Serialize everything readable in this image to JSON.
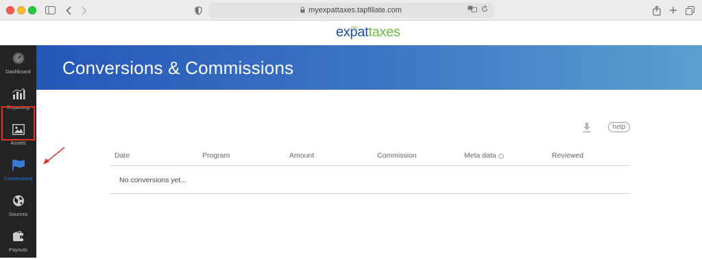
{
  "browser": {
    "url": "myexpattaxes.tapfiliate.com"
  },
  "brand": {
    "my": "my",
    "expat": "expat",
    "taxes": "taxes"
  },
  "sidebar": {
    "items": [
      {
        "label": "Dashboard",
        "icon": "speedometer-icon"
      },
      {
        "label": "Reporting",
        "icon": "bar-chart-icon"
      },
      {
        "label": "Assets",
        "icon": "image-icon"
      },
      {
        "label": "Conversions",
        "icon": "flag-icon",
        "active": true
      },
      {
        "label": "Sources",
        "icon": "globe-icon"
      },
      {
        "label": "Payouts",
        "icon": "wallet-icon"
      }
    ]
  },
  "page": {
    "title": "Conversions & Commissions",
    "help_label": "help"
  },
  "table": {
    "columns": [
      "Date",
      "Program",
      "Amount",
      "Commission",
      "Meta data",
      "Reviewed"
    ],
    "empty_message": "No conversions yet..."
  },
  "colors": {
    "accent": "#2557b8",
    "sidebar_bg": "#232323",
    "active": "#3a7bd5",
    "highlight": "#e0352b",
    "brand_green": "#6dbf3e"
  }
}
